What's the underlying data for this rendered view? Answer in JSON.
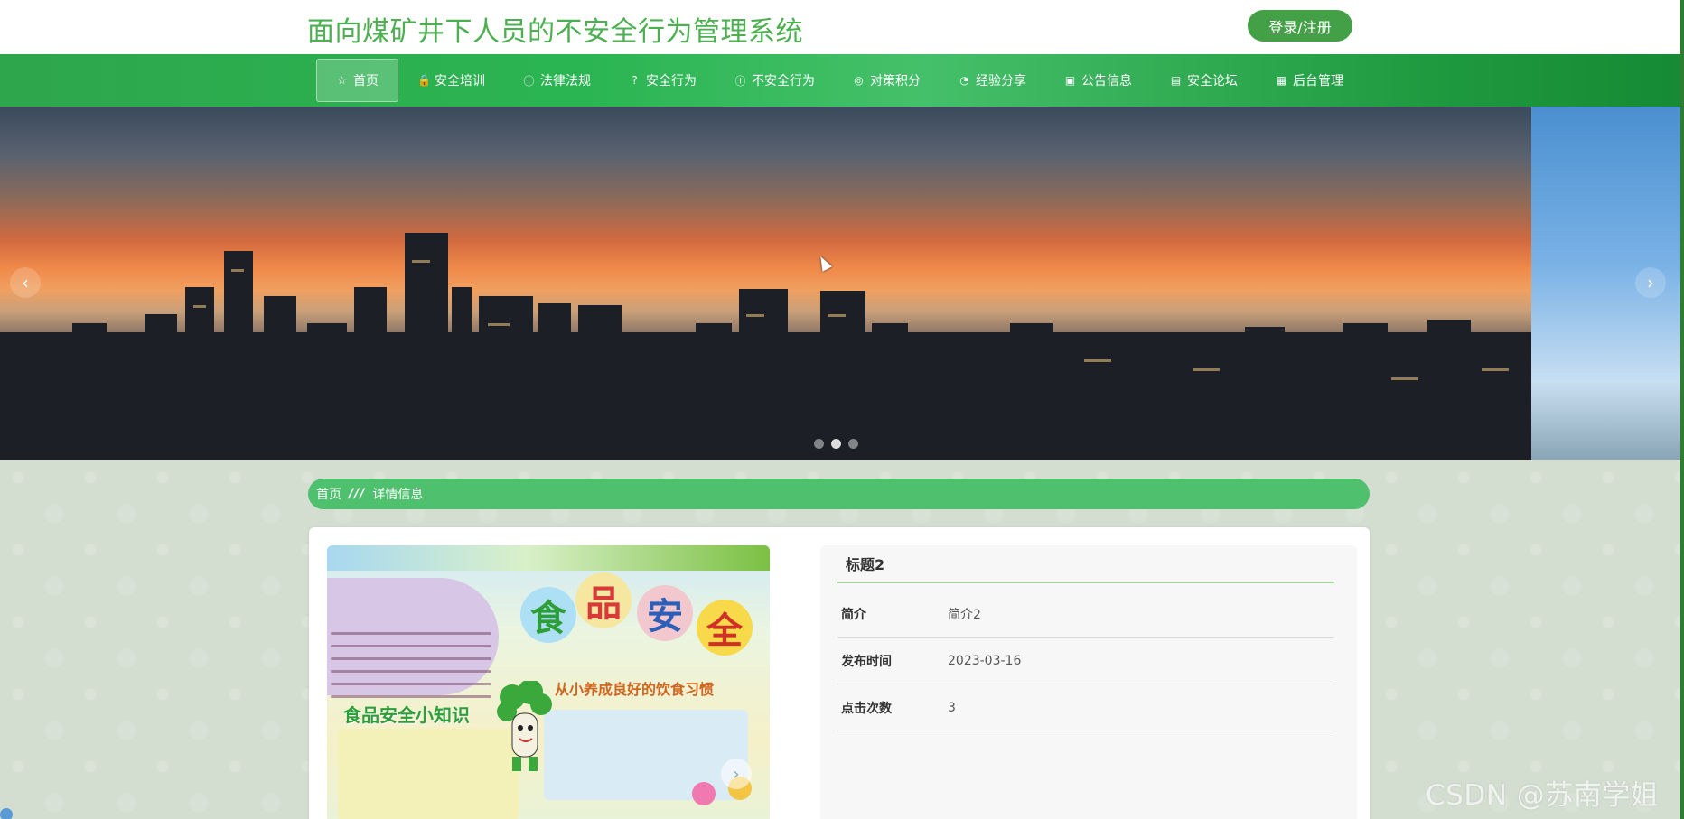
{
  "header": {
    "site_title": "面向煤矿井下人员的不安全行为管理系统",
    "login_label": "登录/注册"
  },
  "nav": {
    "items": [
      {
        "label": "首页",
        "icon": "star-icon",
        "glyph": "☆",
        "active": true
      },
      {
        "label": "安全培训",
        "icon": "lock-icon",
        "glyph": "🔒",
        "active": false
      },
      {
        "label": "法律法规",
        "icon": "info-icon",
        "glyph": "ⓘ",
        "active": false
      },
      {
        "label": "安全行为",
        "icon": "question-icon",
        "glyph": "?",
        "active": false
      },
      {
        "label": "不安全行为",
        "icon": "info-icon",
        "glyph": "ⓘ",
        "active": false
      },
      {
        "label": "对策积分",
        "icon": "target-icon",
        "glyph": "◎",
        "active": false
      },
      {
        "label": "经验分享",
        "icon": "compass-icon",
        "glyph": "◔",
        "active": false
      },
      {
        "label": "公告信息",
        "icon": "camera-icon",
        "glyph": "▣",
        "active": false
      },
      {
        "label": "安全论坛",
        "icon": "truck-icon",
        "glyph": "▤",
        "active": false
      },
      {
        "label": "后台管理",
        "icon": "clipboard-icon",
        "glyph": "▦",
        "active": false
      }
    ]
  },
  "banner": {
    "prev_glyph": "‹",
    "next_glyph": "›",
    "slide_count": 3,
    "active_slide": 2
  },
  "breadcrumb": {
    "home": "首页",
    "separator": "///",
    "current": "详情信息"
  },
  "poster": {
    "chars": [
      "食",
      "品",
      "安",
      "全"
    ],
    "subtitle": "从小养成良好的饮食习惯",
    "knowledge_title": "食品安全小知识",
    "next_glyph": "›"
  },
  "detail": {
    "title": "标题2",
    "rows": [
      {
        "label": "简介",
        "value": "简介2"
      },
      {
        "label": "发布时间",
        "value": "2023-03-16"
      },
      {
        "label": "点击次数",
        "value": "3"
      }
    ]
  },
  "watermark": "CSDN @苏南学姐",
  "colors": {
    "brand_green": "#4caf50",
    "nav_green": "#2bb552",
    "breadcrumb_green": "#4ec06e",
    "login_green": "#43a047"
  }
}
